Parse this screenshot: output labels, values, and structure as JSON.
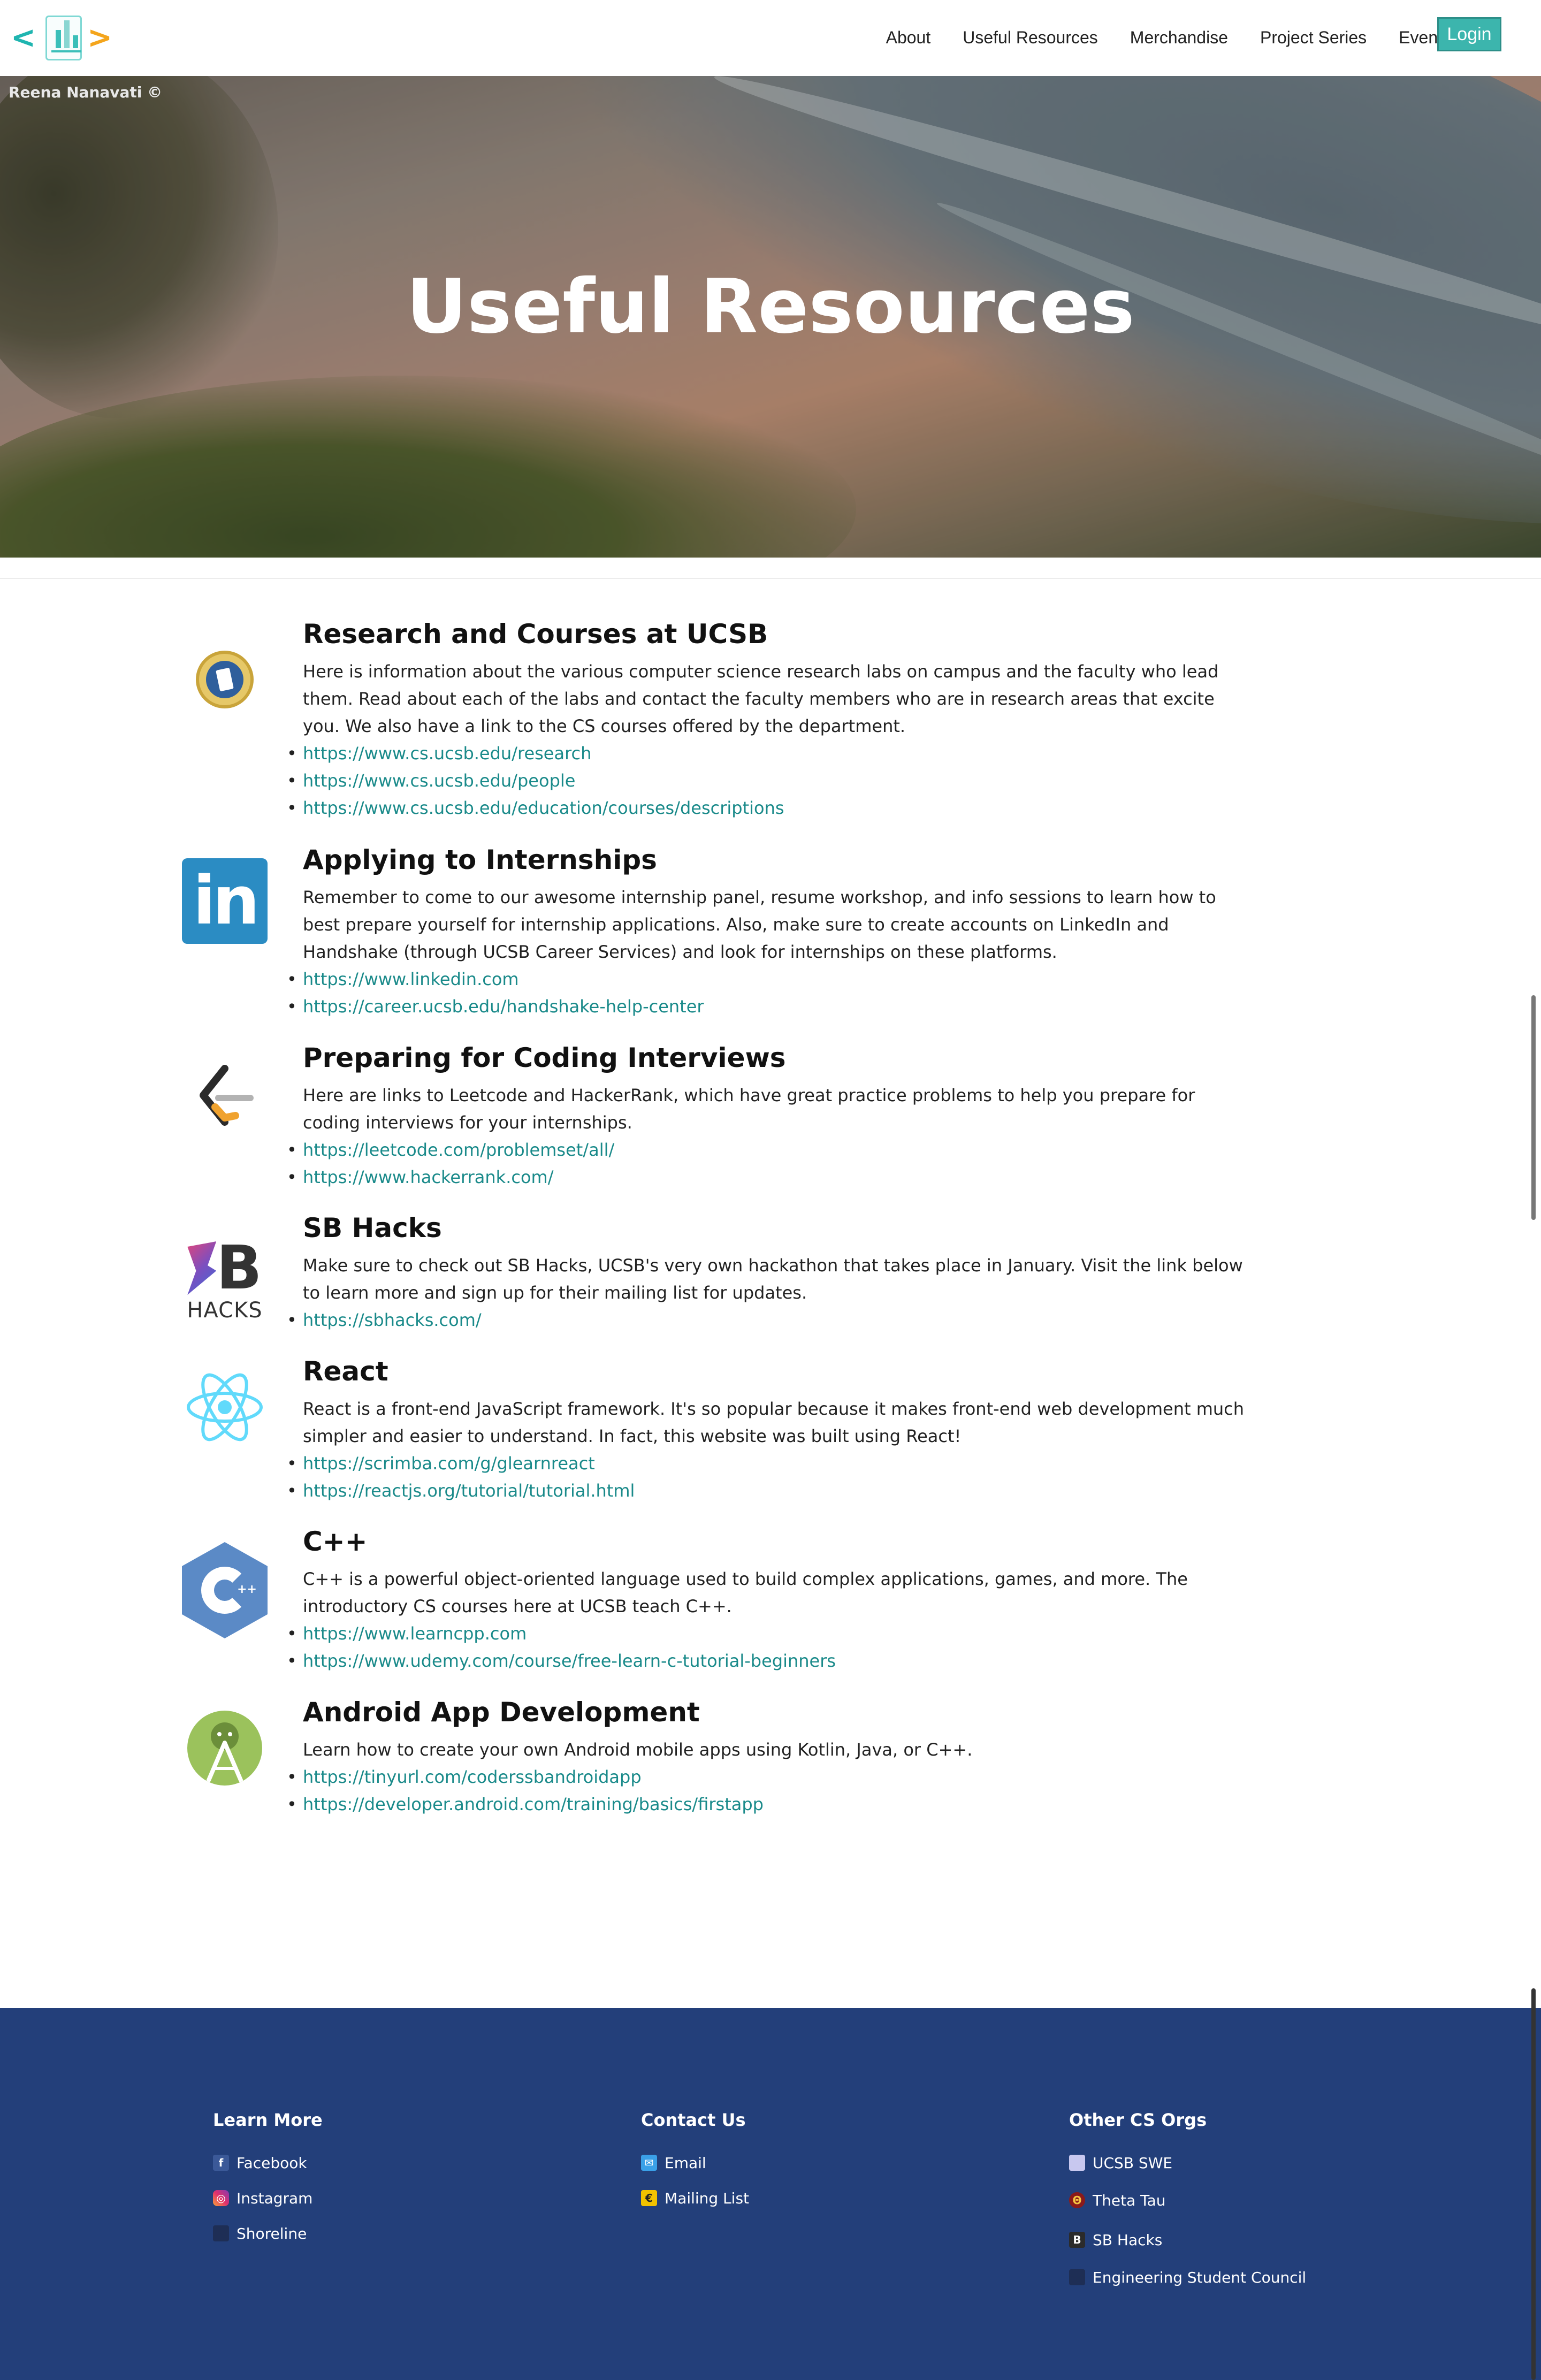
{
  "nav": {
    "logo_left": "<",
    "logo_right": ">",
    "items": [
      "About",
      "Useful Resources",
      "Merchandise",
      "Project Series",
      "Events"
    ],
    "login": "Login"
  },
  "hero": {
    "credit": "Reena Nanavati ©",
    "title": "Useful Resources"
  },
  "sections": [
    {
      "icon": "ucsb-seal-icon",
      "title": "Research and Courses at UCSB",
      "description": "Here is information about the various computer science research labs on campus and the faculty who lead them. Read about each of the labs and contact the faculty members who are in research areas that excite you. We also have a link to the CS courses offered by the department.",
      "links": [
        "https://www.cs.ucsb.edu/research",
        "https://www.cs.ucsb.edu/people",
        "https://www.cs.ucsb.edu/education/courses/descriptions"
      ]
    },
    {
      "icon": "linkedin-icon",
      "title": "Applying to Internships",
      "description": "Remember to come to our awesome internship panel, resume workshop, and info sessions to learn how to best prepare yourself for internship applications. Also, make sure to create accounts on LinkedIn and Handshake (through UCSB Career Services) and look for internships on these platforms.",
      "links": [
        "https://www.linkedin.com",
        "https://career.ucsb.edu/handshake-help-center"
      ]
    },
    {
      "icon": "leetcode-icon",
      "title": "Preparing for Coding Interviews",
      "description": "Here are links to Leetcode and HackerRank, which have great practice problems to help you prepare for coding interviews for your internships.",
      "links": [
        "https://leetcode.com/problemset/all/",
        "https://www.hackerrank.com/"
      ]
    },
    {
      "icon": "sbhacks-icon",
      "title": "SB Hacks",
      "description": "Make sure to check out SB Hacks, UCSB's very own hackathon that takes place in January. Visit the link below to learn more and sign up for their mailing list for updates.",
      "links": [
        "https://sbhacks.com/"
      ]
    },
    {
      "icon": "react-icon",
      "title": "React",
      "description": "React is a front-end JavaScript framework. It's so popular because it makes front-end web development much simpler and easier to understand. In fact, this website was built using React!",
      "links": [
        "https://scrimba.com/g/glearnreact",
        "https://reactjs.org/tutorial/tutorial.html"
      ]
    },
    {
      "icon": "cpp-icon",
      "title": "C++",
      "description": "C++ is a powerful object-oriented language used to build complex applications, games, and more. The introductory CS courses here at UCSB teach C++.",
      "links": [
        "https://www.learncpp.com",
        "https://www.udemy.com/course/free-learn-c-tutorial-beginners"
      ]
    },
    {
      "icon": "android-studio-icon",
      "title": "Android App Development",
      "description": "Learn how to create your own Android mobile apps using Kotlin, Java, or C++.",
      "links": [
        "https://tinyurl.com/coderssbandroidapp",
        "https://developer.android.com/training/basics/firstapp"
      ]
    }
  ],
  "icon_text": {
    "linkedin": "in",
    "sbhacks_b": "B",
    "sbhacks_word": "HACKS",
    "cpp_plus": "++"
  },
  "footer": {
    "learn_more": {
      "heading": "Learn More",
      "items": [
        "Facebook",
        "Instagram",
        "Shoreline"
      ]
    },
    "contact_us": {
      "heading": "Contact Us",
      "items": [
        "Email",
        "Mailing List"
      ]
    },
    "other_orgs": {
      "heading": "Other CS Orgs",
      "items": [
        "UCSB SWE",
        "Theta Tau",
        "SB Hacks",
        "Engineering Student Council"
      ]
    },
    "icon_glyphs": {
      "facebook": "f",
      "instagram": "◎",
      "email": "✉",
      "mailing_list": "€",
      "theta_tau": "Θ",
      "sbhacks": "B"
    }
  },
  "colors": {
    "accent_teal": "#1a8a8a",
    "login_bg": "#3cb5ad",
    "footer_bg": "#233f7a",
    "logo_left_bracket": "#1fb5b0",
    "logo_right_bracket": "#f4a51c"
  }
}
